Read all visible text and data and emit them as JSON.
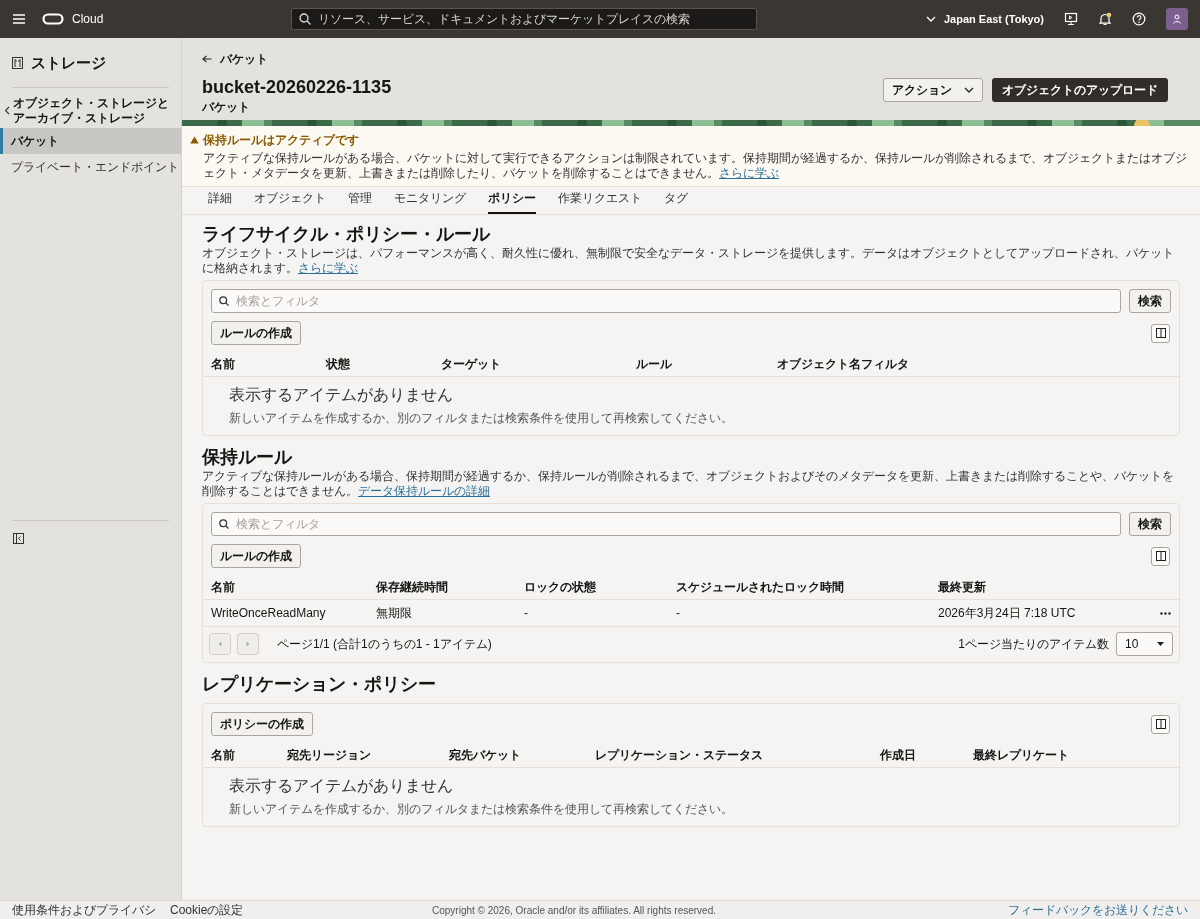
{
  "topbar": {
    "logo": "Cloud",
    "search_placeholder": "リソース、サービス、ドキュメントおよびマーケットプレイスの検索",
    "region": "Japan East (Tokyo)",
    "notification": true
  },
  "sidebar": {
    "title": "ストレージ",
    "back_lines": [
      "オブジェクト・ストレージと",
      "アーカイブ・ストレージ"
    ],
    "items": [
      {
        "label": "バケット",
        "selected": true
      },
      {
        "label": "プライベート・エンドポイント",
        "selected": false
      }
    ]
  },
  "header": {
    "breadcrumb": "バケット",
    "title": "bucket-20260226-1135",
    "subtitle": "バケット",
    "actions_button": "アクション",
    "primary_button": "オブジェクトのアップロード"
  },
  "warning": {
    "title": "保持ルールはアクティブです",
    "text": "アクティブな保持ルールがある場合、バケットに対して実行できるアクションは制限されています。保持期間が経過するか、保持ルールが削除されるまで、オブジェクトまたはオブジェクト・メタデータを更新、上書きまたは削除したり、バケットを削除することはできません。",
    "link": "さらに学ぶ"
  },
  "tabs": [
    {
      "label": "詳細",
      "selected": false
    },
    {
      "label": "オブジェクト",
      "selected": false
    },
    {
      "label": "管理",
      "selected": false
    },
    {
      "label": "モニタリング",
      "selected": false
    },
    {
      "label": "ポリシー",
      "selected": true
    },
    {
      "label": "作業リクエスト",
      "selected": false
    },
    {
      "label": "タグ",
      "selected": false
    }
  ],
  "sections": [
    {
      "title": "ライフサイクル・ポリシー・ルール",
      "description": "オブジェクト・ストレージは、パフォーマンスが高く、耐久性に優れ、無制限で安全なデータ・ストレージを提供します。データはオブジェクトとしてアップロードされ、バケットに格納されます。",
      "link": "さらに学ぶ",
      "search": {
        "placeholder": "検索とフィルタ",
        "button": "検索"
      },
      "create_button": "ルールの作成",
      "columns": [
        "名前",
        "状態",
        "ターゲット",
        "ルール",
        "オブジェクト名フィルタ"
      ],
      "empty": {
        "title": "表示するアイテムがありません",
        "text": "新しいアイテムを作成するか、別のフィルタまたは検索条件を使用して再検索してください。"
      }
    },
    {
      "title": "保持ルール",
      "description": "アクティブな保持ルールがある場合、保持期間が経過するか、保持ルールが削除されるまで、オブジェクトおよびそのメタデータを更新、上書きまたは削除することや、バケットを削除することはできません。",
      "link": "データ保持ルールの詳細",
      "search": {
        "placeholder": "検索とフィルタ",
        "button": "検索"
      },
      "create_button": "ルールの作成",
      "columns": [
        "名前",
        "保存継続時間",
        "ロックの状態",
        "スケジュールされたロック時間",
        "最終更新"
      ],
      "rows": [
        [
          "WriteOnceReadMany",
          "無期限",
          "-",
          "-",
          "2026年3月24日 7:18 UTC"
        ]
      ],
      "pagination": {
        "summary": "ページ1/1 (合計1のうちの1 - 1アイテム)",
        "per_page_label": "1ページ当たりのアイテム数",
        "per_page": "10"
      }
    },
    {
      "title": "レプリケーション・ポリシー",
      "create_button": "ポリシーの作成",
      "columns": [
        "名前",
        "宛先リージョン",
        "宛先バケット",
        "レプリケーション・ステータス",
        "作成日",
        "最終レプリケート"
      ],
      "empty": {
        "title": "表示するアイテムがありません",
        "text": "新しいアイテムを作成するか、別のフィルタまたは検索条件を使用して再検索してください。"
      }
    }
  ],
  "footer": {
    "links": [
      "使用条件およびプライバシ",
      "Cookieの設定"
    ],
    "copyright": "Copyright © 2026, Oracle and/or its affiliates. All rights reserved.",
    "feedback": "フィードバックをお送りください"
  }
}
